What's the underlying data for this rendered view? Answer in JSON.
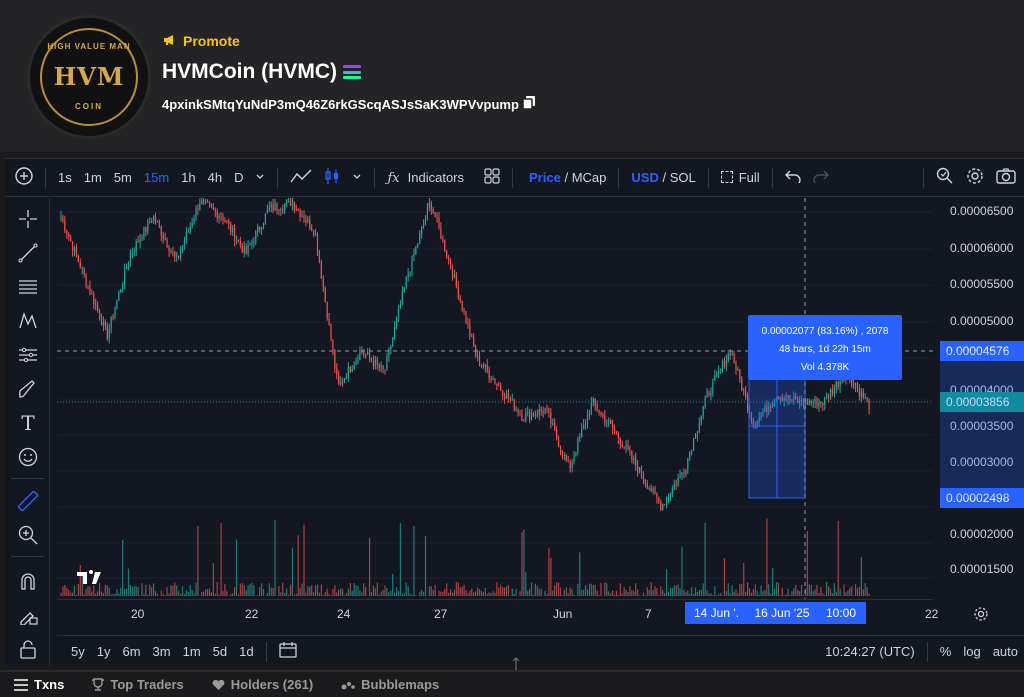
{
  "header": {
    "logo": {
      "top_text": "HIGH VALUE MAN",
      "main_text": "HVM",
      "bottom_text": "COIN"
    },
    "promote_label": "Promote",
    "title": "HVMCoin (HVMC)",
    "address": "4pxinkSMtqYuNdP3mQ46Z6rkGScqASJsSaK3WPVvpump",
    "icons": {
      "promote": "megaphone-icon",
      "chain": "solana-icon",
      "copy": "copy-icon"
    }
  },
  "toolbar": {
    "intervals": [
      "1s",
      "1m",
      "5m",
      "15m",
      "1h",
      "4h",
      "D"
    ],
    "active_interval": "15m",
    "indicators_label": "Indicators",
    "price_label": "Price",
    "mcap_label": "MCap",
    "usd_label": "USD",
    "sol_label": "SOL",
    "full_label": "Full",
    "slash": "/"
  },
  "chart": {
    "y_ticks": [
      "0.00006500",
      "0.00006000",
      "0.00005500",
      "0.00005000",
      "0.00004000",
      "0.00003500",
      "0.00003000",
      "0.00002000",
      "0.00001500"
    ],
    "y_labels": {
      "crosshair": "0.00004576",
      "current": "0.00003856",
      "low": "0.00002498"
    },
    "x_ticks": [
      "20",
      "22",
      "24",
      "27",
      "Jun",
      "7",
      "22"
    ],
    "x_highlight": {
      "start": "14 Jun '.",
      "date": "16 Jun '25",
      "time": "10:00"
    },
    "measure_tooltip": {
      "line1": "0.00002077 (83.16%) , 2078",
      "line2": "48 bars, 1d 22h 15m",
      "line3": "Vol 4.378K"
    },
    "colors": {
      "up": "#26a69a",
      "down": "#ef5350",
      "accent": "#2962ff",
      "current": "#089981"
    }
  },
  "chart_data": {
    "type": "candlestick",
    "x_tick_labels": [
      "20",
      "22",
      "24",
      "27",
      "Jun",
      "7",
      "22"
    ],
    "y_tick_labels": [
      "0.00006500",
      "0.00006000",
      "0.00005500",
      "0.00005000",
      "0.00004000",
      "0.00003500",
      "0.00003000",
      "0.00002000",
      "0.00001500"
    ],
    "close_path": [
      6.4e-05,
      5.6e-05,
      4.8e-05,
      5.9e-05,
      6.4e-05,
      5.8e-05,
      6.6e-05,
      6.4e-05,
      5.9e-05,
      6.5e-05,
      6.6e-05,
      6.2e-05,
      4.1e-05,
      4.6e-05,
      4.3e-05,
      5.6e-05,
      6.6e-05,
      5.6e-05,
      4.5e-05,
      4.1e-05,
      3.7e-05,
      3.8e-05,
      3e-05,
      3.9e-05,
      3.5e-05,
      3e-05,
      2.5e-05,
      3e-05,
      4e-05,
      4.6e-05,
      3.6e-05,
      4e-05,
      3.9e-05,
      3.9e-05,
      4.3e-05,
      3.86e-05
    ],
    "measurement": {
      "change": "0.00002077",
      "percent": "83.16%",
      "bars": 48,
      "duration": "1d 22h 15m",
      "volume": "4.378K"
    },
    "current_price": "0.00003856"
  },
  "bottom": {
    "ranges": [
      "5y",
      "1y",
      "6m",
      "3m",
      "1m",
      "5d",
      "1d"
    ],
    "clock": "10:24:27 (UTC)",
    "percent": "%",
    "log": "log",
    "auto": "auto"
  },
  "tabs": [
    {
      "label": "Txns",
      "icon": "list-icon"
    },
    {
      "label": "Top Traders",
      "icon": "trophy-icon"
    },
    {
      "label": "Holders (261)",
      "icon": "heart-icon"
    },
    {
      "label": "Bubblemaps",
      "icon": "bubblemaps-icon"
    }
  ]
}
